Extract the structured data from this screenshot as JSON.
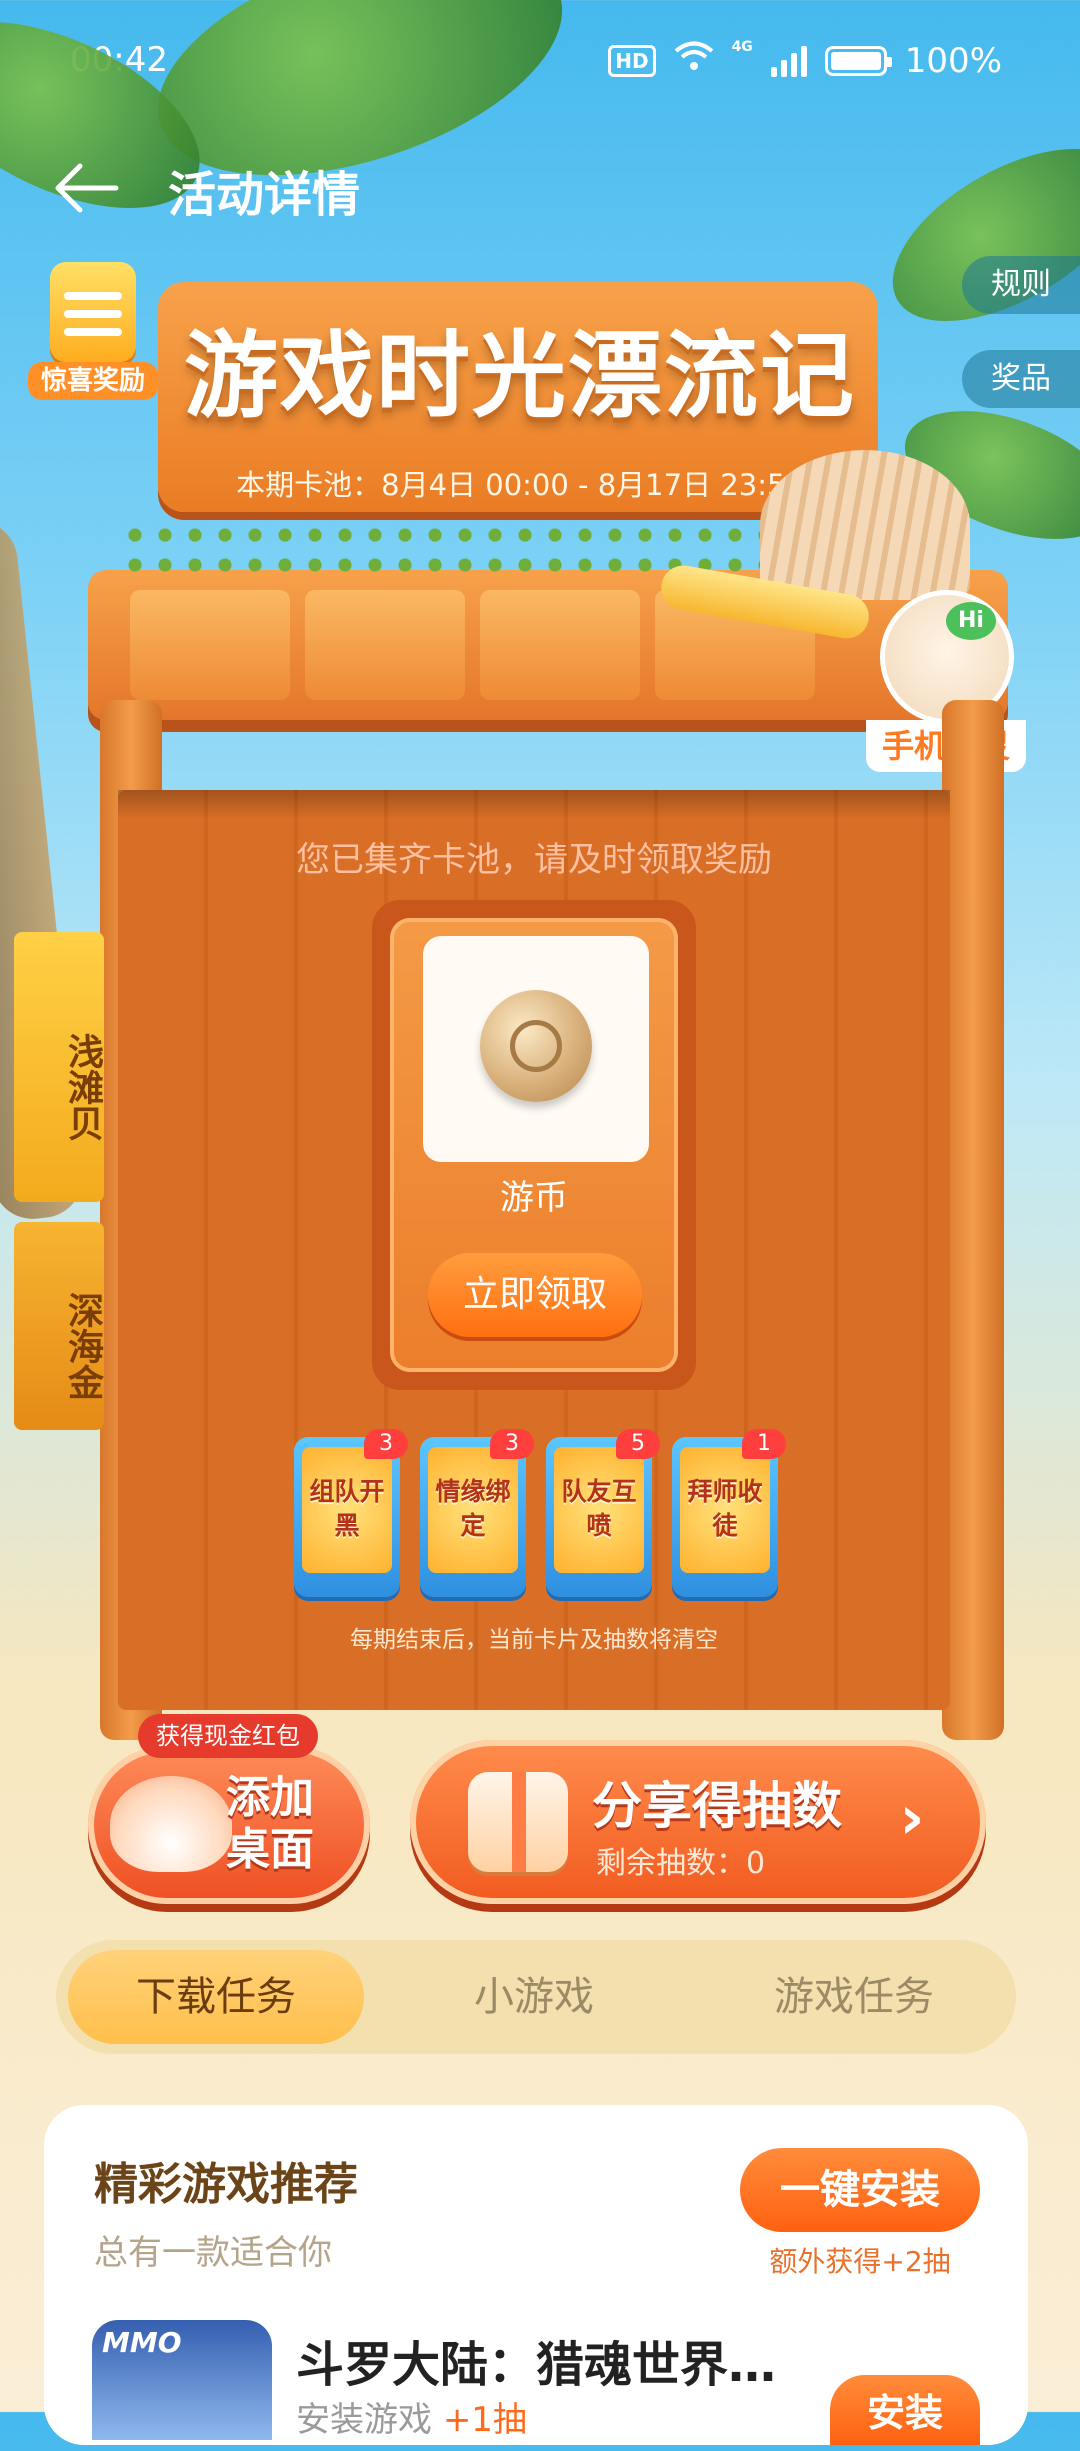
{
  "status_bar": {
    "time": "00:42",
    "hd": "HD",
    "network": "4G",
    "battery": "100%"
  },
  "header": {
    "title": "活动详情"
  },
  "surprise": {
    "label": "惊喜奖励"
  },
  "side_tabs": {
    "rules": "规则",
    "prizes": "奖品"
  },
  "banner": {
    "title": "游戏时光漂流记",
    "period": "本期卡池：8月4日 00:00 - 8月17日 23:59"
  },
  "sprite": {
    "hi": "Hi",
    "name": "手机精灵"
  },
  "booth": {
    "notice": "您已集齐卡池，请及时领取奖励",
    "reward": {
      "name": "游币",
      "claim_label": "立即领取"
    },
    "cards": [
      {
        "label": "组队开黑",
        "count": "3"
      },
      {
        "label": "情缘绑定",
        "count": "3"
      },
      {
        "label": "队友互喷",
        "count": "5"
      },
      {
        "label": "拜师收徒",
        "count": "1"
      }
    ],
    "clear_note": "每期结束后，当前卡片及抽数将清空"
  },
  "shell_tags": {
    "shallow": "浅滩贝",
    "deep": "深海金"
  },
  "actions": {
    "add_badge": "获得现金红包",
    "add_label": "添加桌面",
    "share_title": "分享得抽数",
    "share_sub": "剩余抽数：0",
    "chevron": "›"
  },
  "tabs": [
    "下载任务",
    "小游戏",
    "游戏任务"
  ],
  "recommend": {
    "title": "精彩游戏推荐",
    "subtitle": "总有一款适合你",
    "install_all": "一键安装",
    "extra": "额外获得+2抽",
    "app": {
      "tag": "MMO",
      "name": "斗罗大陆：猎魂世界…",
      "sub_prefix": "安装游戏",
      "sub_bonus": "+1抽",
      "install": "安装"
    }
  },
  "colors": {
    "accent": "#ff6f10",
    "wood": "#d96f27",
    "sky": "#45b9ee"
  }
}
